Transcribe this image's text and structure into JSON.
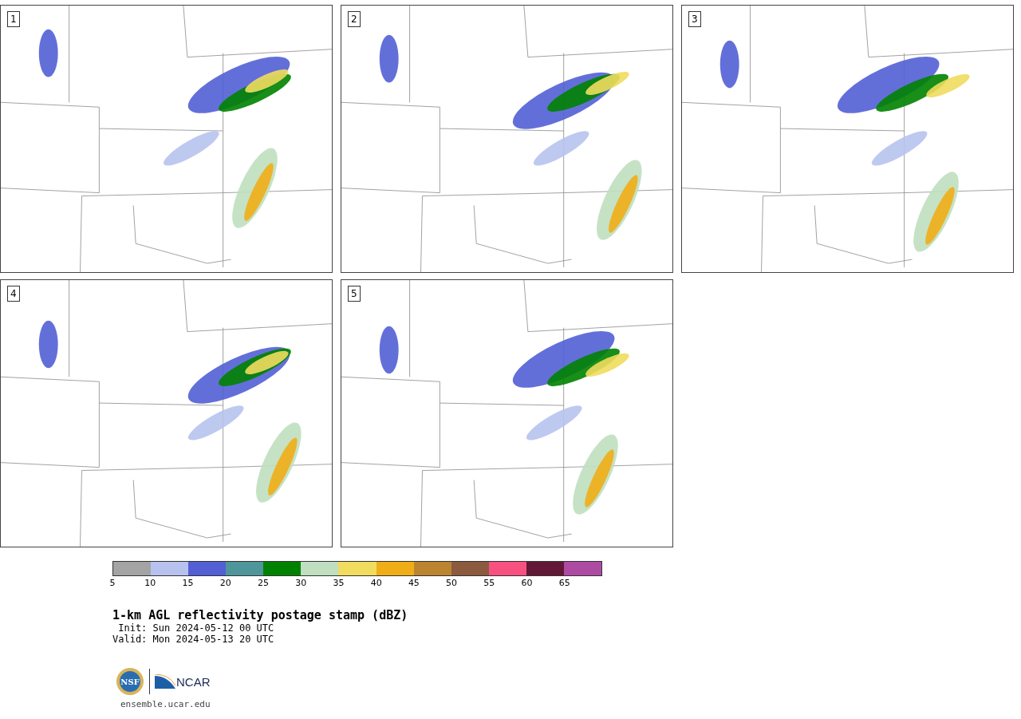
{
  "panels": [
    {
      "number": "1"
    },
    {
      "number": "2"
    },
    {
      "number": "3"
    },
    {
      "number": "4"
    },
    {
      "number": "5"
    }
  ],
  "colorbar": {
    "bins": [
      {
        "color": "#a4a4a4",
        "tick": "5"
      },
      {
        "color": "#b7c3ee",
        "tick": "10"
      },
      {
        "color": "#525fd5",
        "tick": "15"
      },
      {
        "color": "#4f969b",
        "tick": "20"
      },
      {
        "color": "#008200",
        "tick": "25"
      },
      {
        "color": "#bfdfbf",
        "tick": "30"
      },
      {
        "color": "#f0dc5e",
        "tick": "35"
      },
      {
        "color": "#efae17",
        "tick": "40"
      },
      {
        "color": "#bb8431",
        "tick": "45"
      },
      {
        "color": "#8b5a3f",
        "tick": "50"
      },
      {
        "color": "#f75181",
        "tick": "55"
      },
      {
        "color": "#621837",
        "tick": "60"
      },
      {
        "color": "#ad4ba3",
        "tick": "65"
      }
    ]
  },
  "title": "1-km AGL reflectivity postage stamp (dBZ)",
  "init": "Init: Sun 2024-05-12 00 UTC",
  "valid": "Valid: Mon 2024-05-13 20 UTC",
  "logos": {
    "nsf": "NSF",
    "ncar": "NCAR"
  },
  "link": "ensemble.ucar.edu"
}
